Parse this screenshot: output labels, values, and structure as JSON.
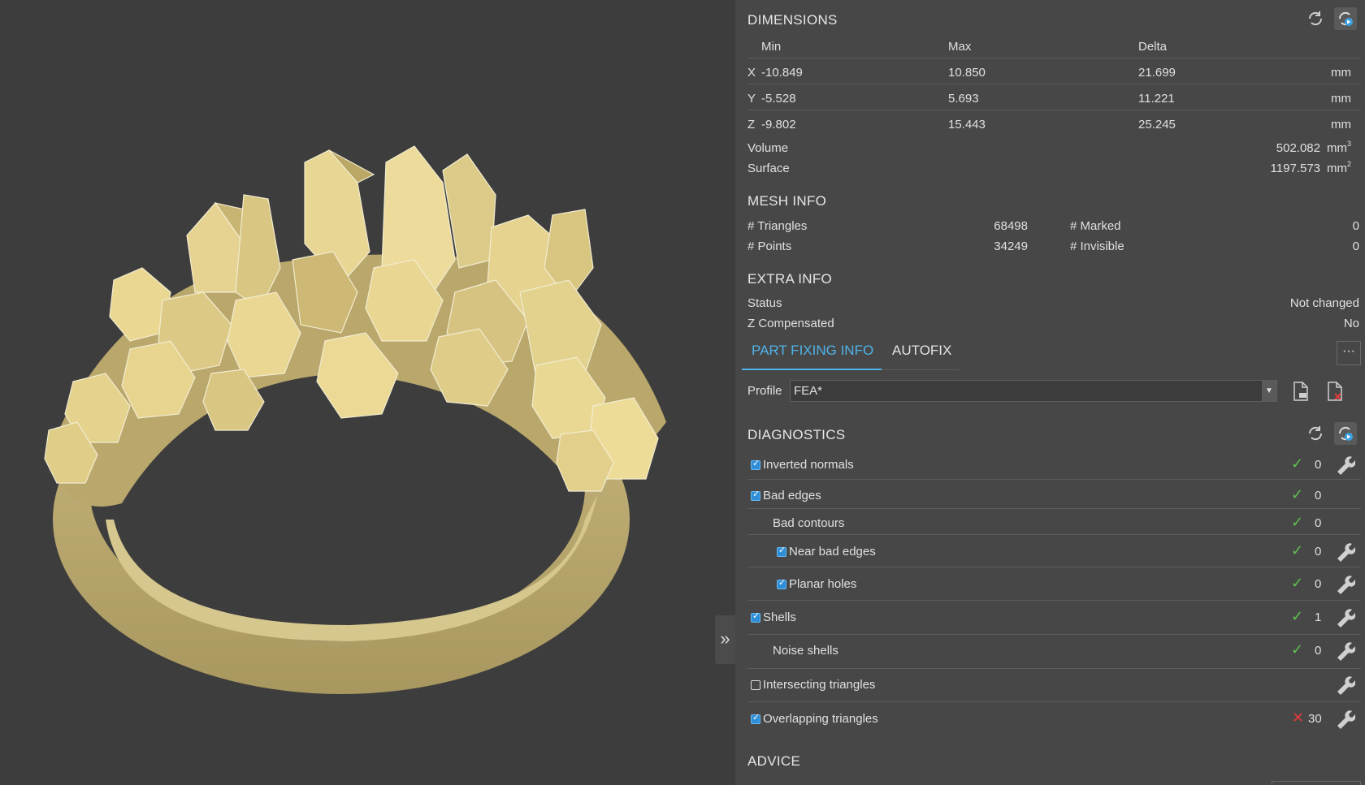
{
  "dimensions": {
    "title": "DIMENSIONS",
    "headers": {
      "min": "Min",
      "max": "Max",
      "delta": "Delta"
    },
    "rows": [
      {
        "axis": "X",
        "min": "-10.849",
        "max": "10.850",
        "delta": "21.699",
        "unit": "mm"
      },
      {
        "axis": "Y",
        "min": "-5.528",
        "max": "5.693",
        "delta": "11.221",
        "unit": "mm"
      },
      {
        "axis": "Z",
        "min": "-9.802",
        "max": "15.443",
        "delta": "25.245",
        "unit": "mm"
      }
    ],
    "volume_label": "Volume",
    "volume_value": "502.082",
    "volume_unit": "mm",
    "surface_label": "Surface",
    "surface_value": "1197.573",
    "surface_unit": "mm"
  },
  "mesh_info": {
    "title": "MESH INFO",
    "triangles_label": "# Triangles",
    "triangles_value": "68498",
    "points_label": "# Points",
    "points_value": "34249",
    "marked_label": "# Marked",
    "marked_value": "0",
    "invisible_label": "# Invisible",
    "invisible_value": "0"
  },
  "extra_info": {
    "title": "EXTRA INFO",
    "status_label": "Status",
    "status_value": "Not changed",
    "zcomp_label": "Z Compensated",
    "zcomp_value": "No"
  },
  "tabs": {
    "part_fixing": "PART FIXING INFO",
    "autofix": "AUTOFIX",
    "more": "···"
  },
  "profile": {
    "label": "Profile",
    "value": "FEA*"
  },
  "diagnostics": {
    "title": "DIAGNOSTICS",
    "items": [
      {
        "label": "Inverted normals",
        "count": "0"
      },
      {
        "label": "Bad edges",
        "count": "0"
      },
      {
        "label": "Bad contours",
        "count": "0"
      },
      {
        "label": "Near bad edges",
        "count": "0"
      },
      {
        "label": "Planar holes",
        "count": "0"
      },
      {
        "label": "Shells",
        "count": "1"
      },
      {
        "label": "Noise shells",
        "count": "0"
      },
      {
        "label": "Intersecting triangles",
        "count": ""
      },
      {
        "label": "Overlapping triangles",
        "count": "30"
      }
    ]
  },
  "advice": {
    "title": "ADVICE"
  },
  "viewport": {
    "collapse_glyph": "»"
  },
  "colors": {
    "accent": "#4fb3e8",
    "ok": "#5fc24e",
    "error": "#e23b3b",
    "gold": "#d8c88c"
  }
}
